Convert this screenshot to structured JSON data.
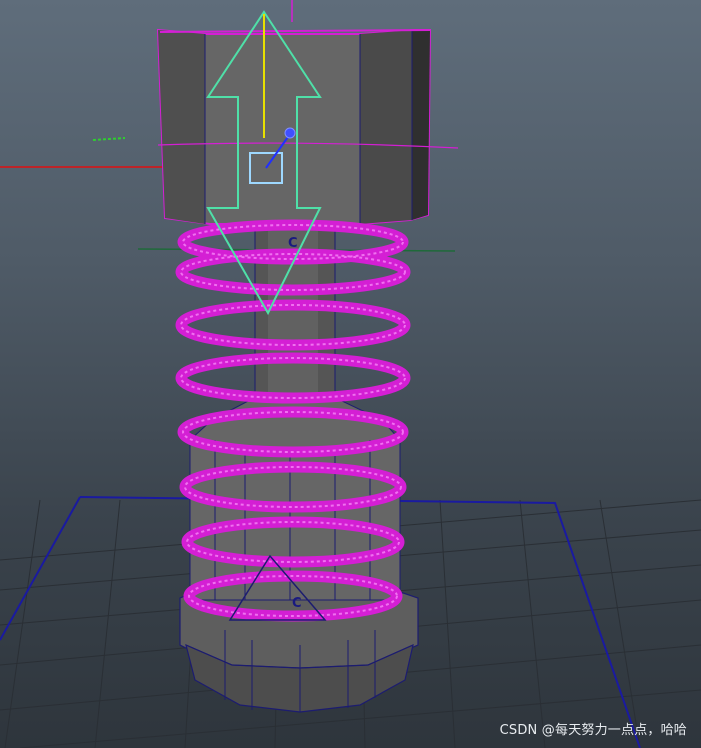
{
  "viewport": {
    "pivot_marker_label_top": "C",
    "pivot_marker_label_bottom": "C",
    "watermark": "CSDN @每天努力一点点，哈哈"
  },
  "colors": {
    "background_top": "#5f6d7b",
    "background_bottom": "#2e353c",
    "grid_line": "#2a2f35",
    "grid_border": "#1a1aa0",
    "selection": "#d41fd4",
    "manipulator": "#4fe0a8",
    "axis_x": "#e01010",
    "axis_y": "#e8e000",
    "axis_z": "#2030ff",
    "mesh_face": "#6b6b6b",
    "mesh_face_dark": "#4a4a4a",
    "mesh_edge": "#1c1c70"
  },
  "icons": {
    "move_manipulator": "move-manipulator-icon",
    "pivot_point": "pivot-point-icon"
  }
}
